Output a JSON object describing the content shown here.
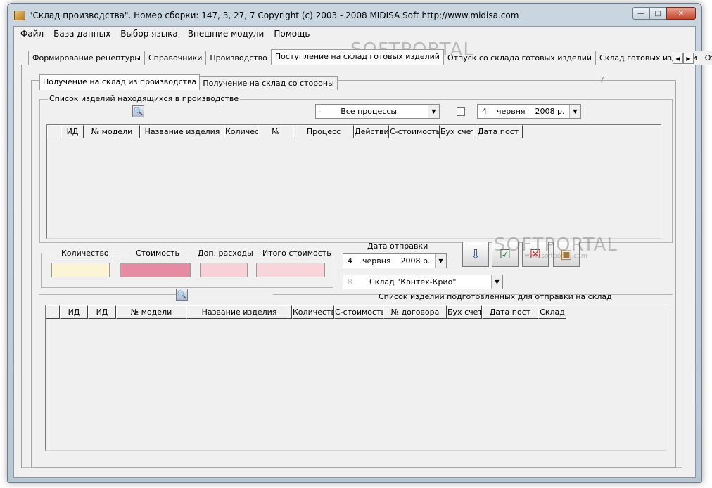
{
  "window": {
    "title": "\"Склад производства\". Номер сборки: 147, 3, 27, 7     Copyright (c) 2003 - 2008 MIDISA Soft http://www.midisa.com",
    "buttons": {
      "minimize": "—",
      "maximize": "□",
      "close": "✕"
    }
  },
  "menu": [
    "Файл",
    "База данных",
    "Выбор языка",
    "Внешние модули",
    "Помощь"
  ],
  "main_tabs": [
    "Формирование рецептуры",
    "Справочники",
    "Производство",
    "Поступление на склад готовых изделий",
    "Отпуск со склада готовых изделий",
    "Склад готовых изделий",
    "Отчеты"
  ],
  "active_main_tab": "Поступление на склад готовых изделий",
  "tab_scroll": {
    "left": "◀",
    "right": "▶"
  },
  "sub_tabs": [
    "Получение на склад из производства",
    "Получение на склад со стороны"
  ],
  "counter": "7",
  "production_list": {
    "title": "Список изделий находящихся в производстве",
    "process_combo": {
      "value": "Все процессы",
      "hint": "-"
    },
    "date_combo": {
      "day": "4",
      "month": "червня",
      "year": "2008 р."
    },
    "columns": [
      "ИД",
      "№ модели",
      "Название изделия",
      "Количес",
      "№",
      "Процесс",
      "Действи",
      "С-стоимость",
      "Бух счет",
      "Дата пост"
    ]
  },
  "totals": {
    "quantity_label": "Количество",
    "cost_label": "Стоимость",
    "extra_label": "Доп. расходы",
    "total_label": "Итого стоимость",
    "colors": {
      "quantity": "#fcf5d4",
      "cost": "#e68ba1",
      "extra": "#f8d1d6",
      "total": "#f9d4d8"
    }
  },
  "shipment": {
    "date_label": "Дата отправки",
    "date_combo": {
      "day": "4",
      "month": "червня",
      "year": "2008 р."
    },
    "warehouse_combo": {
      "hint": "8",
      "value": "Склад \"Контех-Крио\""
    }
  },
  "action_buttons": [
    "move-down-icon",
    "checklist-icon",
    "delete-list-icon",
    "package-icon"
  ],
  "prepared_list": {
    "title": "Список изделий подготовленных для отправки на склад",
    "columns": [
      "ИД",
      "ИД",
      "№ модели",
      "Название изделия",
      "Количеств",
      "С-стоимость",
      "№ договора",
      "Бух счет",
      "Дата пост",
      "Склад"
    ]
  },
  "watermark": {
    "brand": "SOFTPORTAL",
    "url": "www.softportal.com"
  }
}
